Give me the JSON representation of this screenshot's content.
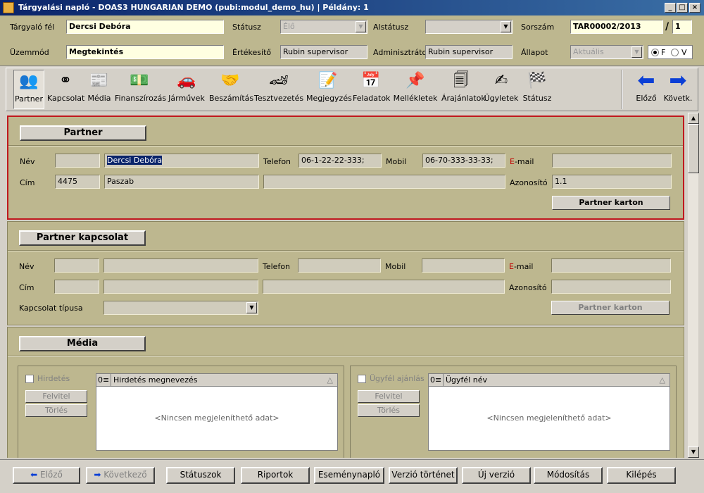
{
  "window": {
    "title": "Tárgyalási napló - DOAS3 HUNGARIAN DEMO (pubi:modul_demo_hu) | Példány: 1",
    "controls": [
      "_",
      "□",
      "×"
    ]
  },
  "header": {
    "targyalo_fel_label": "Tárgyaló fél",
    "targyalo_fel_value": "Dercsi Debóra",
    "statusz_label": "Státusz",
    "statusz_value": "Élő",
    "alstatusz_label": "Alstátusz",
    "alstatusz_value": "",
    "sorszam_label": "Sorszám",
    "sorszam_value": "TAR00002/2013",
    "sorszam_sep": "/",
    "sorszam_suffix": "1",
    "uzemmod_label": "Üzemmód",
    "uzemmod_value": "Megtekintés",
    "ertekesito_label": "Értékesítő",
    "ertekesito_value": "Rubin supervisor",
    "adminisztrator_label": "Adminisztrátor",
    "adminisztrator_value": "Rubin supervisor",
    "allapot_label": "Állapot",
    "allapot_value": "Aktuális",
    "radio_f": "F",
    "radio_v": "V"
  },
  "toolbar": {
    "items": [
      {
        "label": "Partner",
        "icon": "partner-icon"
      },
      {
        "label": "Kapcsolat",
        "icon": "link-icon"
      },
      {
        "label": "Média",
        "icon": "media-icon"
      },
      {
        "label": "Finanszírozás",
        "icon": "money-icon"
      },
      {
        "label": "Járművek",
        "icon": "car-icon"
      },
      {
        "label": "Beszámítás",
        "icon": "handshake-icon"
      },
      {
        "label": "Tesztvezetés",
        "icon": "race-car-icon"
      },
      {
        "label": "Megjegyzés",
        "icon": "note-icon"
      },
      {
        "label": "Feladatok",
        "icon": "calendar-icon"
      },
      {
        "label": "Mellékletek",
        "icon": "pin-icon"
      },
      {
        "label": "Árajánlatok",
        "icon": "documents-icon"
      },
      {
        "label": "Ügyletek",
        "icon": "contract-icon"
      },
      {
        "label": "Státusz",
        "icon": "checkered-flag-icon"
      }
    ],
    "prev_label": "Előző",
    "next_label": "Követk."
  },
  "partner": {
    "section_title": "Partner",
    "nev_label": "Név",
    "nev_prefix": "",
    "nev_value": "Dercsi Debóra",
    "telefon_label": "Telefon",
    "telefon_value": "06-1-22-22-333;",
    "mobil_label": "Mobil",
    "mobil_value": "06-70-333-33-33;",
    "email_label_e": "E",
    "email_label_rest": "-mail",
    "email_value": "",
    "cim_label": "Cím",
    "zip_value": "4475",
    "city_value": "Paszab",
    "street_value": "",
    "azonosito_label": "Azonosító",
    "azonosito_value": "1.1",
    "karton_button": "Partner karton"
  },
  "partner_kapcsolat": {
    "section_title": "Partner kapcsolat",
    "nev_label": "Név",
    "telefon_label": "Telefon",
    "mobil_label": "Mobil",
    "email_label_e": "E",
    "email_label_rest": "-mail",
    "cim_label": "Cím",
    "azonosito_label": "Azonosító",
    "kapcsolat_tipusa_label": "Kapcsolat típusa",
    "karton_button": "Partner karton"
  },
  "media": {
    "section_title": "Média",
    "left": {
      "checkbox_label": "Hirdetés",
      "add_button": "Felvitel",
      "delete_button": "Törlés",
      "count": "0",
      "column": "Hirdetés megnevezés",
      "empty_text": "<Nincsen megjeleníthető adat>"
    },
    "right": {
      "checkbox_label": "Ügyfél ajánlás",
      "add_button": "Felvitel",
      "delete_button": "Törlés",
      "count": "0",
      "column": "Ügyfél név",
      "empty_text": "<Nincsen megjeleníthető adat>"
    }
  },
  "bottom": {
    "buttons": [
      {
        "label": "Előző",
        "enabled": false
      },
      {
        "label": "Következő",
        "enabled": false
      },
      {
        "label": "Státuszok",
        "enabled": true
      },
      {
        "label": "Riportok",
        "enabled": true
      },
      {
        "label": "Eseménynapló",
        "enabled": true
      },
      {
        "label": "Verzió történet",
        "enabled": true
      },
      {
        "label": "Új verzió",
        "enabled": true
      },
      {
        "label": "Módosítás",
        "enabled": true
      },
      {
        "label": "Kilépés",
        "enabled": true
      }
    ]
  },
  "colors": {
    "title_bar": "#0a246a",
    "panel_bg": "#bdb78f",
    "selected_border": "#c0181e",
    "highlight_field": "#ffffe1",
    "accent_red": "#c00000",
    "arrow_blue": "#0b3fd6"
  }
}
